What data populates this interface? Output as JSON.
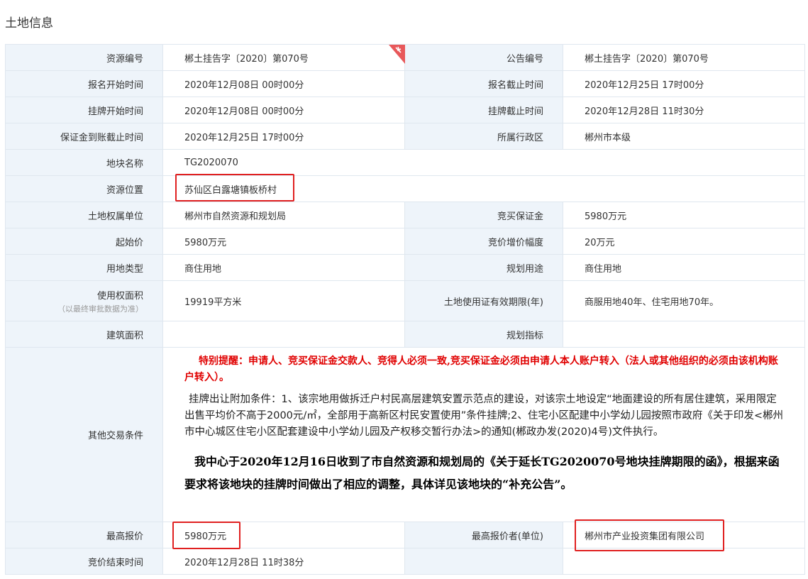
{
  "page_title": "土地信息",
  "rows": {
    "r1": {
      "l1": "资源编号",
      "v1": "郴土挂告字〔2020〕第070号",
      "l2": "公告编号",
      "v2": "郴土挂告字〔2020〕第070号"
    },
    "r2": {
      "l1": "报名开始时间",
      "v1": "2020年12月08日 00时00分",
      "l2": "报名截止时间",
      "v2": "2020年12月25日 17时00分"
    },
    "r3": {
      "l1": "挂牌开始时间",
      "v1": "2020年12月08日 00时00分",
      "l2": "挂牌截止时间",
      "v2": "2020年12月28日 11时30分"
    },
    "r4": {
      "l1": "保证金到账截止时间",
      "v1": "2020年12月25日 17时00分",
      "l2": "所属行政区",
      "v2": "郴州市本级"
    },
    "r5": {
      "l1": "地块名称",
      "v1": "TG2020070"
    },
    "r6": {
      "l1": "资源位置",
      "v1": "苏仙区白露塘镇板桥村"
    },
    "r7": {
      "l1": "土地权属单位",
      "v1": "郴州市自然资源和规划局",
      "l2": "竞买保证金",
      "v2": "5980万元"
    },
    "r8": {
      "l1": "起始价",
      "v1": "5980万元",
      "l2": "竞价增价幅度",
      "v2": "20万元"
    },
    "r9": {
      "l1": "用地类型",
      "v1": "商住用地",
      "l2": "规划用途",
      "v2": "商住用地"
    },
    "r10": {
      "l1": "使用权面积",
      "l1_sub": "（以最终审批数据为准）",
      "v1": "19919平方米",
      "l2": "土地使用证有效期限(年)",
      "v2": "商服用地40年、住宅用地70年。"
    },
    "r11": {
      "l1": "建筑面积",
      "v1": "",
      "l2": "规划指标",
      "v2": ""
    },
    "r12": {
      "l1": "其他交易条件"
    },
    "r13": {
      "l1": "最高报价",
      "v1": "5980万元",
      "l2": "最高报价者(单位)",
      "v2": "郴州市产业投资集团有限公司"
    },
    "r14": {
      "l1": "竞价结束时间",
      "v1": "2020年12月28日 11时38分",
      "l2": "",
      "v2": ""
    }
  },
  "notice": {
    "warning": "特别提醒：申请人、竞买保证金交款人、竞得人必须一致,竞买保证金必须由申请人本人账户转入（法人或其他组织的必须由该机构账户转入）。",
    "conditions": "挂牌出让附加条件：1、该宗地用做拆迁户村民高层建筑安置示范点的建设，对该宗土地设定“地面建设的所有居住建筑，采用限定出售平均价不高于2000元/㎡，全部用于高新区村民安置使用”条件挂牌;2、住宅小区配建中小学幼儿园按照市政府《关于印发<郴州市中心城区住宅小区配套建设中小学幼儿园及产权移交暂行办法>的通知(郴政办发(2020)4号)文件执行。",
    "extension": "我中心于2020年12月16日收到了市自然资源和规划局的《关于延长TG2020070号地块挂牌期限的函》，根据来函要求将该地块的挂牌时间做出了相应的调整，具体详见该地块的“补充公告”。"
  },
  "corner_badge_icon": "ribbon-tag-icon",
  "colors": {
    "label_bg": "#eef4fa",
    "border": "#dfe7ef",
    "highlight": "#e02020",
    "warning_text": "#e00000",
    "badge": "#e8585a"
  }
}
